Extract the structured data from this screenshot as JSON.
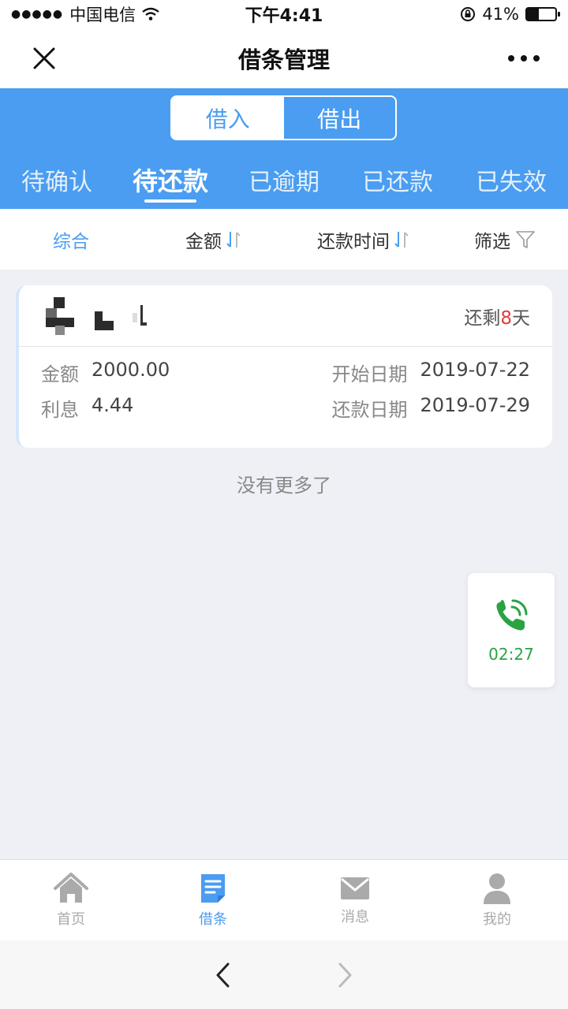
{
  "status_bar": {
    "signal": "●●●●●",
    "carrier": "中国电信",
    "time": "下午4:41",
    "battery_text": "41%",
    "battery_level": 0.41
  },
  "nav": {
    "title": "借条管理"
  },
  "segment": {
    "items": [
      "借入",
      "借出"
    ],
    "active_index": 0
  },
  "status_tabs": {
    "items": [
      "待确认",
      "待还款",
      "已逾期",
      "已还款",
      "已失效"
    ],
    "active_index": 1
  },
  "sort_bar": {
    "overall": "综合",
    "amount": "金额",
    "repay_time": "还款时间",
    "filter": "筛选"
  },
  "loan_card": {
    "remain_prefix": "还剩",
    "remain_days": "8",
    "remain_suffix": "天",
    "amount_label": "金额",
    "amount_value": "2000.00",
    "interest_label": "利息",
    "interest_value": "4.44",
    "start_label": "开始日期",
    "start_value": "2019-07-22",
    "repay_label": "还款日期",
    "repay_value": "2019-07-29"
  },
  "no_more_text": "没有更多了",
  "call_widget": {
    "time": "02:27"
  },
  "tab_bar": {
    "items": [
      {
        "label": "首页",
        "icon": "home-icon"
      },
      {
        "label": "借条",
        "icon": "document-icon"
      },
      {
        "label": "消息",
        "icon": "mail-icon"
      },
      {
        "label": "我的",
        "icon": "user-icon"
      }
    ],
    "active_index": 1
  },
  "colors": {
    "primary": "#4a9df0",
    "remain_days": "#e53c3c",
    "call_green": "#2aa343",
    "background": "#eff0f5"
  }
}
